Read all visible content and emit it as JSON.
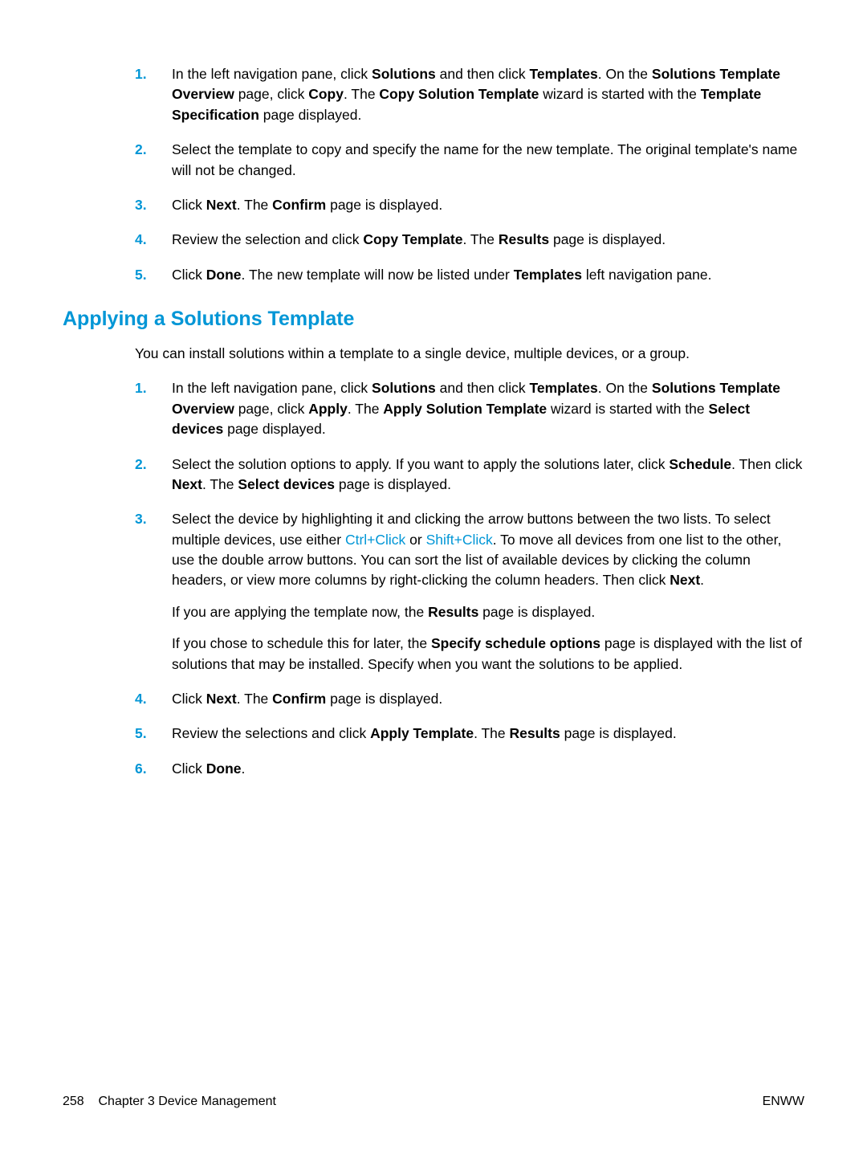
{
  "list1": {
    "items": [
      {
        "num": "1.",
        "paragraphs": [
          [
            {
              "t": "In the left navigation pane, click "
            },
            {
              "t": "Solutions",
              "b": true
            },
            {
              "t": " and then click "
            },
            {
              "t": "Templates",
              "b": true
            },
            {
              "t": ". On the "
            },
            {
              "t": "Solutions Template Overview",
              "b": true
            },
            {
              "t": " page, click "
            },
            {
              "t": "Copy",
              "b": true
            },
            {
              "t": ". The "
            },
            {
              "t": "Copy Solution Template",
              "b": true
            },
            {
              "t": " wizard is started with the "
            },
            {
              "t": "Template Specification",
              "b": true
            },
            {
              "t": " page displayed."
            }
          ]
        ]
      },
      {
        "num": "2.",
        "paragraphs": [
          [
            {
              "t": "Select the template to copy and specify the name for the new template. The original template's name will not be changed."
            }
          ]
        ]
      },
      {
        "num": "3.",
        "paragraphs": [
          [
            {
              "t": "Click "
            },
            {
              "t": "Next",
              "b": true
            },
            {
              "t": ". The "
            },
            {
              "t": "Confirm",
              "b": true
            },
            {
              "t": " page is displayed."
            }
          ]
        ]
      },
      {
        "num": "4.",
        "paragraphs": [
          [
            {
              "t": "Review the selection and click "
            },
            {
              "t": "Copy Template",
              "b": true
            },
            {
              "t": ". The "
            },
            {
              "t": "Results",
              "b": true
            },
            {
              "t": " page is displayed."
            }
          ]
        ]
      },
      {
        "num": "5.",
        "paragraphs": [
          [
            {
              "t": "Click "
            },
            {
              "t": "Done",
              "b": true
            },
            {
              "t": ". The new template will now be listed under "
            },
            {
              "t": "Templates",
              "b": true
            },
            {
              "t": " left navigation pane."
            }
          ]
        ]
      }
    ]
  },
  "heading": "Applying a Solutions Template",
  "intro": [
    {
      "t": "You can install solutions within a template to a single device, multiple devices, or a group."
    }
  ],
  "list2": {
    "items": [
      {
        "num": "1.",
        "paragraphs": [
          [
            {
              "t": "In the left navigation pane, click "
            },
            {
              "t": "Solutions",
              "b": true
            },
            {
              "t": " and then click "
            },
            {
              "t": "Templates",
              "b": true
            },
            {
              "t": ". On the "
            },
            {
              "t": "Solutions Template Overview",
              "b": true
            },
            {
              "t": " page, click "
            },
            {
              "t": "Apply",
              "b": true
            },
            {
              "t": ". The "
            },
            {
              "t": "Apply Solution Template",
              "b": true
            },
            {
              "t": " wizard is started with the "
            },
            {
              "t": "Select devices",
              "b": true
            },
            {
              "t": " page displayed."
            }
          ]
        ]
      },
      {
        "num": "2.",
        "paragraphs": [
          [
            {
              "t": "Select the solution options to apply. If you want to apply the solutions later, click "
            },
            {
              "t": "Schedule",
              "b": true
            },
            {
              "t": ". Then click "
            },
            {
              "t": "Next",
              "b": true
            },
            {
              "t": ". The "
            },
            {
              "t": "Select devices",
              "b": true
            },
            {
              "t": " page is displayed."
            }
          ]
        ]
      },
      {
        "num": "3.",
        "paragraphs": [
          [
            {
              "t": "Select the device by highlighting it and clicking the arrow buttons between the two lists. To select multiple devices, use either "
            },
            {
              "t": "Ctrl+Click",
              "link": true
            },
            {
              "t": " or "
            },
            {
              "t": "Shift+Click",
              "link": true
            },
            {
              "t": ". To move all devices from one list to the other, use the double arrow buttons. You can sort the list of available devices by clicking the column headers, or view more columns by right-clicking the column headers. Then click "
            },
            {
              "t": "Next",
              "b": true
            },
            {
              "t": "."
            }
          ],
          [
            {
              "t": "If you are applying the template now, the "
            },
            {
              "t": "Results",
              "b": true
            },
            {
              "t": " page is displayed."
            }
          ],
          [
            {
              "t": "If you chose to schedule this for later, the "
            },
            {
              "t": "Specify schedule options",
              "b": true
            },
            {
              "t": " page is displayed with the list of solutions that may be installed. Specify when you want the solutions to be applied."
            }
          ]
        ]
      },
      {
        "num": "4.",
        "paragraphs": [
          [
            {
              "t": "Click "
            },
            {
              "t": "Next",
              "b": true
            },
            {
              "t": ". The "
            },
            {
              "t": "Confirm",
              "b": true
            },
            {
              "t": " page is displayed."
            }
          ]
        ]
      },
      {
        "num": "5.",
        "paragraphs": [
          [
            {
              "t": "Review the selections and click "
            },
            {
              "t": "Apply Template",
              "b": true
            },
            {
              "t": ". The "
            },
            {
              "t": "Results",
              "b": true
            },
            {
              "t": " page is displayed."
            }
          ]
        ]
      },
      {
        "num": "6.",
        "paragraphs": [
          [
            {
              "t": "Click "
            },
            {
              "t": "Done",
              "b": true
            },
            {
              "t": "."
            }
          ]
        ]
      }
    ]
  },
  "footer": {
    "left_page": "258",
    "left_chapter": "Chapter 3   Device Management",
    "right": "ENWW"
  }
}
